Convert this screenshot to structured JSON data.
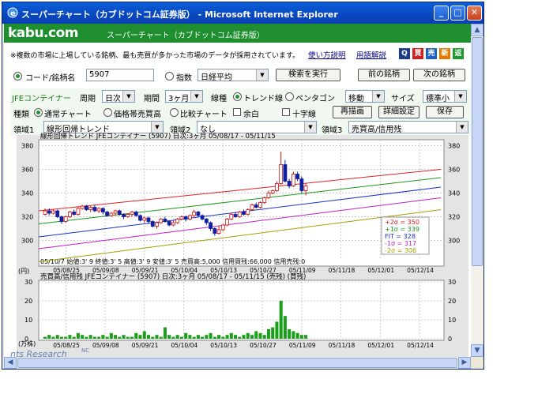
{
  "window": {
    "title": "スーパーチャート（カブドットコム証券版） - Microsoft Internet Explorer",
    "minimize": "_",
    "maximize": "□",
    "close": "✕"
  },
  "header": {
    "logo": "kabu.com",
    "subtitle": "スーパーチャート（カブドットコム証券版）"
  },
  "notice": "※複数の市場に上場している銘柄、最も売買が多かった市場のデータが採用されています。",
  "links": {
    "howto": "使い方説明",
    "glossary": "用語解説"
  },
  "mini_icons": [
    {
      "label": "Q",
      "color": "#1b3a8c"
    },
    {
      "label": "買",
      "color": "#d01f1f"
    },
    {
      "label": "売",
      "color": "#1a62c9"
    },
    {
      "label": "新",
      "color": "#e07a00"
    },
    {
      "label": "返",
      "color": "#1d9a2c"
    }
  ],
  "search": {
    "code_label": "コード/銘柄名",
    "code_value": "5907",
    "index_label": "指数",
    "index_value": "日経平均",
    "run_button": "検索を実行",
    "prev_button": "前の銘柄",
    "next_button": "次の銘柄"
  },
  "controls": {
    "company": "JFEコンテイナー",
    "period_label": "周期",
    "period_value": "日次",
    "duration_label": "期間",
    "duration_value": "3ヶ月",
    "line_label": "線種",
    "line_opt1": "トレンド線",
    "line_opt2": "ペンタゴン",
    "move_value": "移動",
    "size_label": "サイズ",
    "size_value": "標準小",
    "kind_label": "種類",
    "kind_opt1": "通常チャート",
    "kind_opt2": "価格帯売買高",
    "kind_opt3": "比較チャート",
    "chk1": "余白",
    "chk2": "十字線",
    "redraw_button": "再描画",
    "detail_button": "詳細設定",
    "save_button": "保存",
    "area1_label": "領域1",
    "area1_value": "線形回帰トレンド",
    "area2_label": "領域2",
    "area2_value": "なし",
    "area3_label": "領域3",
    "area3_value": "売買高/信用残"
  },
  "chart_data": [
    {
      "type": "line",
      "title": "線形回帰トレンド JFEコンテイナー (5907) 日次:3ヶ月 05/08/17 - 05/11/15",
      "ylabel": "(円)",
      "ylim": [
        285,
        385
      ],
      "yticks": [
        300,
        320,
        340,
        360,
        380
      ],
      "xticks": [
        "05/08/25",
        "05/09/08",
        "05/09/21",
        "05/10/04",
        "05/10/13",
        "05/10/27",
        "05/11/09",
        "05/11/18",
        "05/12/01",
        "05/12/14"
      ],
      "info_line": "05/10/7 始値:3' 9 終値:3' 5 高値:3' 9 安値:3' 5 売買高:5,000 信用買残:66,000 信用売残:0",
      "legend": [
        {
          "label": "+2σ = 350",
          "color": "#e02020"
        },
        {
          "label": "+1σ = 339",
          "color": "#1a9a1a"
        },
        {
          "label": "FIT = 328",
          "color": "#1a30c8"
        },
        {
          "label": "-1σ = 317",
          "color": "#c020c0"
        },
        {
          "label": "-2σ = 306",
          "color": "#a0a000"
        }
      ],
      "bands": [
        {
          "name": "+2σ",
          "start": 325,
          "end": 360,
          "color": "#e02020"
        },
        {
          "name": "+1σ",
          "start": 314,
          "end": 353,
          "color": "#1a9a1a"
        },
        {
          "name": "FIT",
          "start": 303,
          "end": 345,
          "color": "#1a30c8"
        },
        {
          "name": "-1σ",
          "start": 293,
          "end": 336,
          "color": "#c020c0"
        },
        {
          "name": "-2σ",
          "start": 282,
          "end": 326,
          "color": "#a0a000"
        }
      ],
      "candles": [
        [
          322,
          325,
          327,
          321
        ],
        [
          325,
          323,
          327,
          321
        ],
        [
          323,
          325,
          326,
          322
        ],
        [
          325,
          320,
          326,
          319
        ],
        [
          320,
          316,
          321,
          314
        ],
        [
          316,
          320,
          321,
          315
        ],
        [
          320,
          324,
          325,
          319
        ],
        [
          324,
          322,
          326,
          321
        ],
        [
          322,
          327,
          328,
          321
        ],
        [
          327,
          329,
          330,
          326
        ],
        [
          329,
          326,
          330,
          325
        ],
        [
          326,
          328,
          329,
          324
        ],
        [
          328,
          325,
          330,
          324
        ],
        [
          325,
          327,
          328,
          323
        ],
        [
          327,
          324,
          328,
          322
        ],
        [
          324,
          321,
          325,
          320
        ],
        [
          321,
          323,
          324,
          320
        ],
        [
          323,
          325,
          326,
          321
        ],
        [
          325,
          322,
          326,
          321
        ],
        [
          322,
          320,
          323,
          318
        ],
        [
          320,
          322,
          323,
          319
        ],
        [
          322,
          324,
          325,
          320
        ],
        [
          324,
          321,
          325,
          320
        ],
        [
          321,
          317,
          322,
          316
        ],
        [
          317,
          319,
          320,
          315
        ],
        [
          319,
          316,
          320,
          314
        ],
        [
          316,
          312,
          317,
          311
        ],
        [
          312,
          315,
          316,
          310
        ],
        [
          315,
          318,
          319,
          314
        ],
        [
          318,
          316,
          320,
          315
        ],
        [
          316,
          313,
          317,
          312
        ],
        [
          313,
          315,
          317,
          312
        ],
        [
          315,
          318,
          319,
          314
        ],
        [
          318,
          320,
          321,
          317
        ],
        [
          320,
          318,
          321,
          316
        ],
        [
          318,
          321,
          322,
          317
        ],
        [
          321,
          324,
          326,
          320
        ],
        [
          324,
          321,
          325,
          320
        ],
        [
          321,
          318,
          322,
          317
        ],
        [
          318,
          315,
          319,
          313
        ],
        [
          315,
          310,
          316,
          308
        ],
        [
          310,
          306,
          311,
          304
        ],
        [
          306,
          309,
          312,
          305
        ],
        [
          309,
          313,
          314,
          308
        ],
        [
          313,
          318,
          319,
          312
        ],
        [
          318,
          322,
          323,
          317
        ],
        [
          322,
          320,
          324,
          319
        ],
        [
          320,
          324,
          325,
          319
        ],
        [
          324,
          322,
          326,
          321
        ],
        [
          322,
          326,
          327,
          321
        ],
        [
          326,
          330,
          331,
          325
        ],
        [
          330,
          328,
          332,
          327
        ],
        [
          328,
          332,
          333,
          327
        ],
        [
          332,
          336,
          337,
          331
        ],
        [
          336,
          340,
          342,
          335
        ],
        [
          340,
          342,
          343,
          339
        ],
        [
          342,
          348,
          350,
          341
        ],
        [
          348,
          364,
          375,
          347
        ],
        [
          364,
          350,
          368,
          349
        ],
        [
          350,
          346,
          352,
          344
        ],
        [
          346,
          356,
          358,
          345
        ],
        [
          356,
          352,
          358,
          350
        ],
        [
          352,
          342,
          354,
          340
        ],
        [
          342,
          346,
          348,
          338
        ]
      ]
    },
    {
      "type": "bar",
      "title": "売買高/信用残 JFEコンテイナー (5907) 日次:3ヶ月 05/08/17 - 05/11/15 (売残) (買残)",
      "ylabel": "(万株)",
      "ylim": [
        0,
        30
      ],
      "yticks": [
        0,
        10,
        20,
        30
      ],
      "xticks": [
        "05/08/25",
        "05/09/08",
        "05/09/21",
        "05/10/04",
        "05/10/13",
        "05/10/27",
        "05/11/09",
        "05/11/18",
        "05/12/01",
        "05/12/14"
      ],
      "values": [
        1,
        2,
        1,
        2,
        1,
        1,
        2,
        1,
        3,
        2,
        1,
        2,
        1,
        1,
        2,
        1,
        3,
        2,
        1,
        2,
        1,
        1,
        3,
        2,
        4,
        2,
        1,
        2,
        1,
        6,
        2,
        1,
        2,
        1,
        3,
        2,
        1,
        2,
        1,
        2,
        3,
        1,
        2,
        1,
        2,
        3,
        2,
        1,
        2,
        3,
        2,
        4,
        3,
        2,
        5,
        6,
        9,
        20,
        12,
        5,
        4,
        3,
        2,
        2
      ]
    }
  ],
  "footer": {
    "brand": "nts Research",
    "brand_suffix": "NC"
  }
}
